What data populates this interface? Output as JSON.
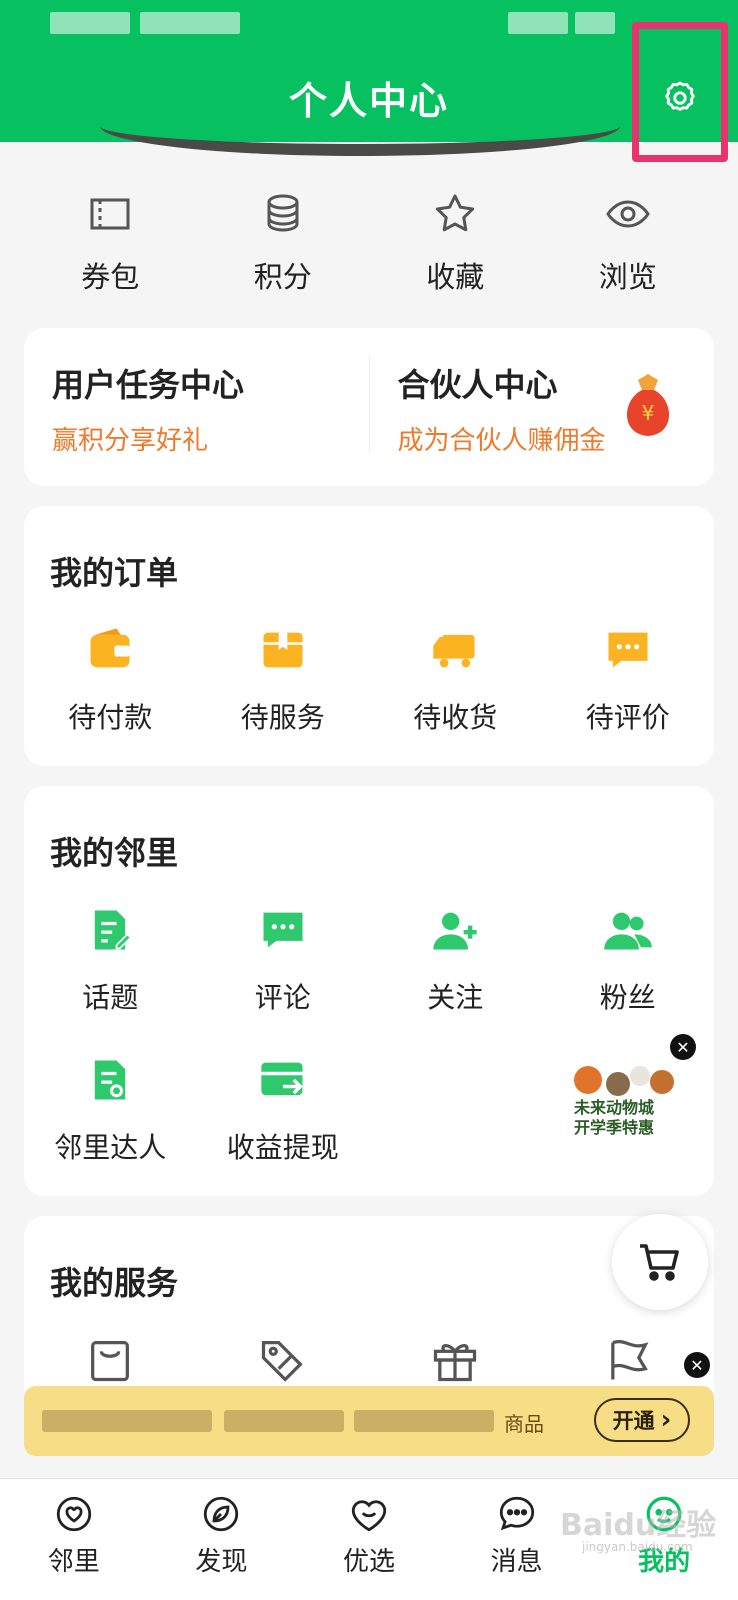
{
  "header": {
    "title": "个人中心"
  },
  "quick_links": [
    {
      "label": "券包",
      "icon": "ticket-icon"
    },
    {
      "label": "积分",
      "icon": "coins-icon"
    },
    {
      "label": "收藏",
      "icon": "star-icon"
    },
    {
      "label": "浏览",
      "icon": "eye-icon"
    }
  ],
  "promo": {
    "task": {
      "title": "用户任务中心",
      "subtitle": "赢积分享好礼"
    },
    "partner": {
      "title": "合伙人中心",
      "subtitle": "成为合伙人赚佣金",
      "badge_glyph": "¥"
    }
  },
  "orders": {
    "title": "我的订单",
    "items": [
      {
        "label": "待付款",
        "icon": "wallet-icon"
      },
      {
        "label": "待服务",
        "icon": "box-icon"
      },
      {
        "label": "待收货",
        "icon": "truck-icon"
      },
      {
        "label": "待评价",
        "icon": "comment-icon"
      }
    ]
  },
  "neighbors": {
    "title": "我的邻里",
    "items": [
      {
        "label": "话题",
        "icon": "topic-icon"
      },
      {
        "label": "评论",
        "icon": "comment-icon"
      },
      {
        "label": "关注",
        "icon": "follow-icon"
      },
      {
        "label": "粉丝",
        "icon": "fans-icon"
      },
      {
        "label": "邻里达人",
        "icon": "expert-icon"
      },
      {
        "label": "收益提现",
        "icon": "withdraw-icon"
      }
    ]
  },
  "float_ad": {
    "line1": "未来动物城",
    "line2": "开学季特惠"
  },
  "services": {
    "title": "我的服务",
    "items": [
      {
        "icon": "bag-icon"
      },
      {
        "icon": "discount-tag-icon"
      },
      {
        "icon": "gift-icon"
      },
      {
        "icon": "flag-icon"
      }
    ]
  },
  "vip_banner": {
    "fragment": "商品",
    "button": "开通",
    "button_glyph": "›"
  },
  "tabs": [
    {
      "label": "邻里",
      "icon": "heart-location-icon"
    },
    {
      "label": "发现",
      "icon": "compass-leaf-icon"
    },
    {
      "label": "优选",
      "icon": "smile-heart-icon"
    },
    {
      "label": "消息",
      "icon": "chat-bubble-icon"
    },
    {
      "label": "我的",
      "icon": "profile-icon",
      "active": true
    }
  ],
  "watermark": {
    "brand": "Baidu经验",
    "url": "jingyan.baidu.com"
  },
  "colors": {
    "brand_green": "#07c160",
    "accent_orange": "#ee7a2d",
    "highlight_pink": "#e8336e",
    "banner_yellow": "#f6dd86",
    "icon_orange": "#fbb321"
  }
}
